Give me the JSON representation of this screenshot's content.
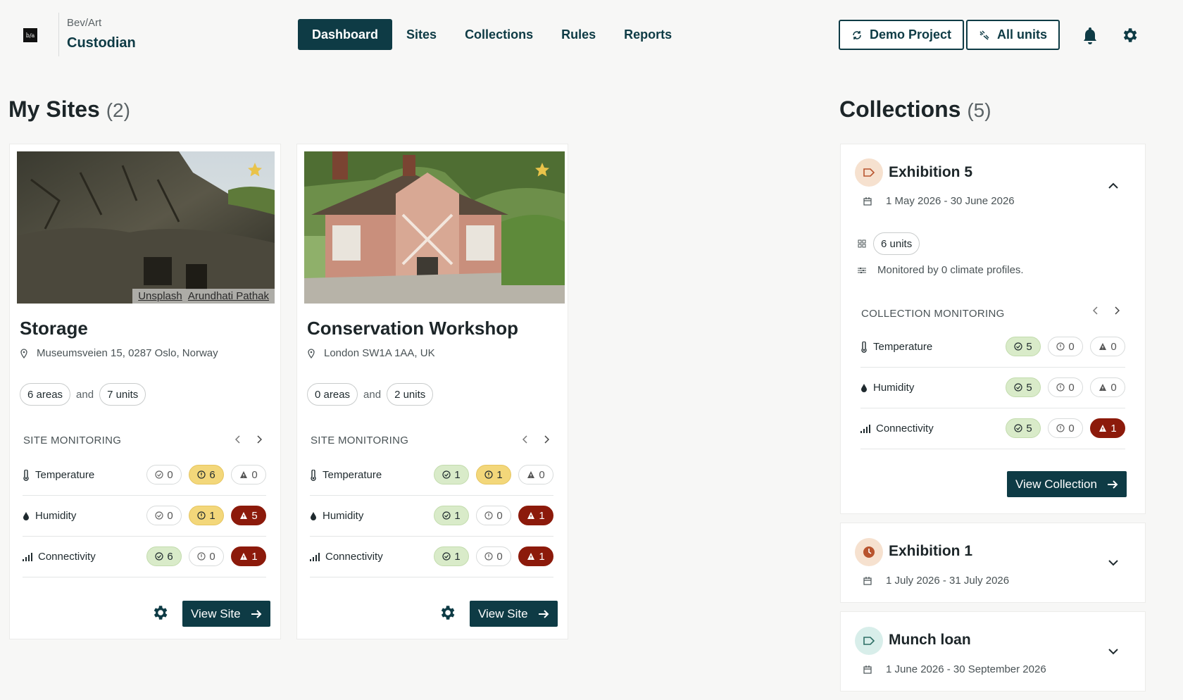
{
  "header": {
    "logo_text": "b/a",
    "org": "Bev/Art",
    "app": "Custodian",
    "nav": [
      "Dashboard",
      "Sites",
      "Collections",
      "Rules",
      "Reports"
    ],
    "project_button": "Demo Project",
    "units_button": "All units"
  },
  "sites_section": {
    "title": "My Sites",
    "count": "(2)"
  },
  "collections_section": {
    "title": "Collections",
    "count": "(5)"
  },
  "sites": [
    {
      "name": "Storage",
      "address": "Museumsveien 15, 0287 Oslo, Norway",
      "credit_source": "Unsplash",
      "credit_author": "Arundhati Pathak",
      "areas": "6 areas",
      "and": "and",
      "units": "7 units",
      "monitoring_title": "SITE MONITORING",
      "rows": [
        {
          "label": "Temperature",
          "ok": "0",
          "warn": "6",
          "alert": "0"
        },
        {
          "label": "Humidity",
          "ok": "0",
          "warn": "1",
          "alert": "5"
        },
        {
          "label": "Connectivity",
          "ok": "6",
          "warn": "0",
          "alert": "1"
        }
      ],
      "view_label": "View Site"
    },
    {
      "name": "Conservation Workshop",
      "address": "London SW1A 1AA, UK",
      "areas": "0 areas",
      "and": "and",
      "units": "2 units",
      "monitoring_title": "SITE MONITORING",
      "rows": [
        {
          "label": "Temperature",
          "ok": "1",
          "warn": "1",
          "alert": "0"
        },
        {
          "label": "Humidity",
          "ok": "1",
          "warn": "0",
          "alert": "1"
        },
        {
          "label": "Connectivity",
          "ok": "1",
          "warn": "0",
          "alert": "1"
        }
      ],
      "view_label": "View Site"
    }
  ],
  "collections": [
    {
      "name": "Exhibition 5",
      "dates": "1 May 2026  -  30 June 2026",
      "units": "6 units",
      "monitored_text": "Monitored by 0 climate profiles.",
      "monitoring_title": "COLLECTION MONITORING",
      "rows": [
        {
          "label": "Temperature",
          "ok": "5",
          "warn": "0",
          "alert": "0"
        },
        {
          "label": "Humidity",
          "ok": "5",
          "warn": "0",
          "alert": "0"
        },
        {
          "label": "Connectivity",
          "ok": "5",
          "warn": "0",
          "alert": "1"
        }
      ],
      "view_label": "View Collection"
    },
    {
      "name": "Exhibition 1",
      "dates": "1 July 2026  -  31 July 2026"
    },
    {
      "name": "Munch loan",
      "dates": "1 June 2026  -  30 September 2026"
    }
  ],
  "colors": {
    "brand": "#0e3b45",
    "ok": "#d9ebc9",
    "warn": "#f3d77a",
    "alert": "#8c1a0b"
  }
}
